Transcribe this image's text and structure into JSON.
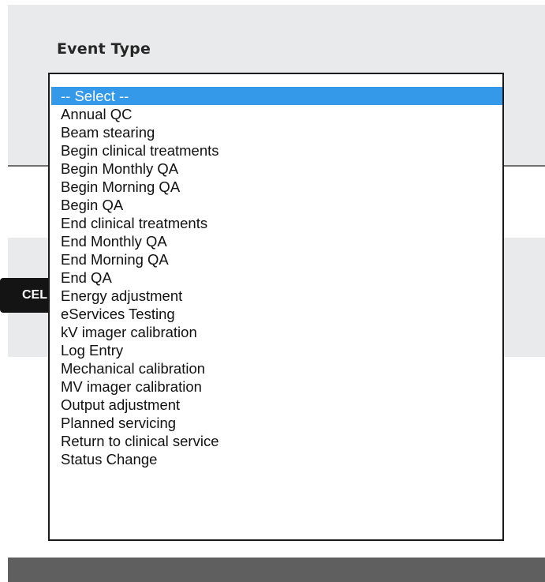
{
  "form": {
    "event_type_label": "Event Type"
  },
  "buttons": {
    "cancel_partial_label": "CEL"
  },
  "dropdown": {
    "selected_index": 0,
    "options": [
      "-- Select --",
      "Annual QC",
      "Beam stearing",
      "Begin clinical treatments",
      "Begin Monthly QA",
      "Begin Morning QA",
      "Begin QA",
      "End clinical treatments",
      "End Monthly QA",
      "End Morning QA",
      "End QA",
      "Energy adjustment",
      "eServices Testing",
      "kV imager calibration",
      "Log Entry",
      "Mechanical calibration",
      "MV imager calibration",
      "Output adjustment",
      "Planned servicing",
      "Return to clinical service",
      "Status Change"
    ]
  },
  "colors": {
    "panel_bg": "#e9eaeb",
    "selected_option_bg": "#3399e8",
    "bottom_bar": "#5f5f5f"
  }
}
